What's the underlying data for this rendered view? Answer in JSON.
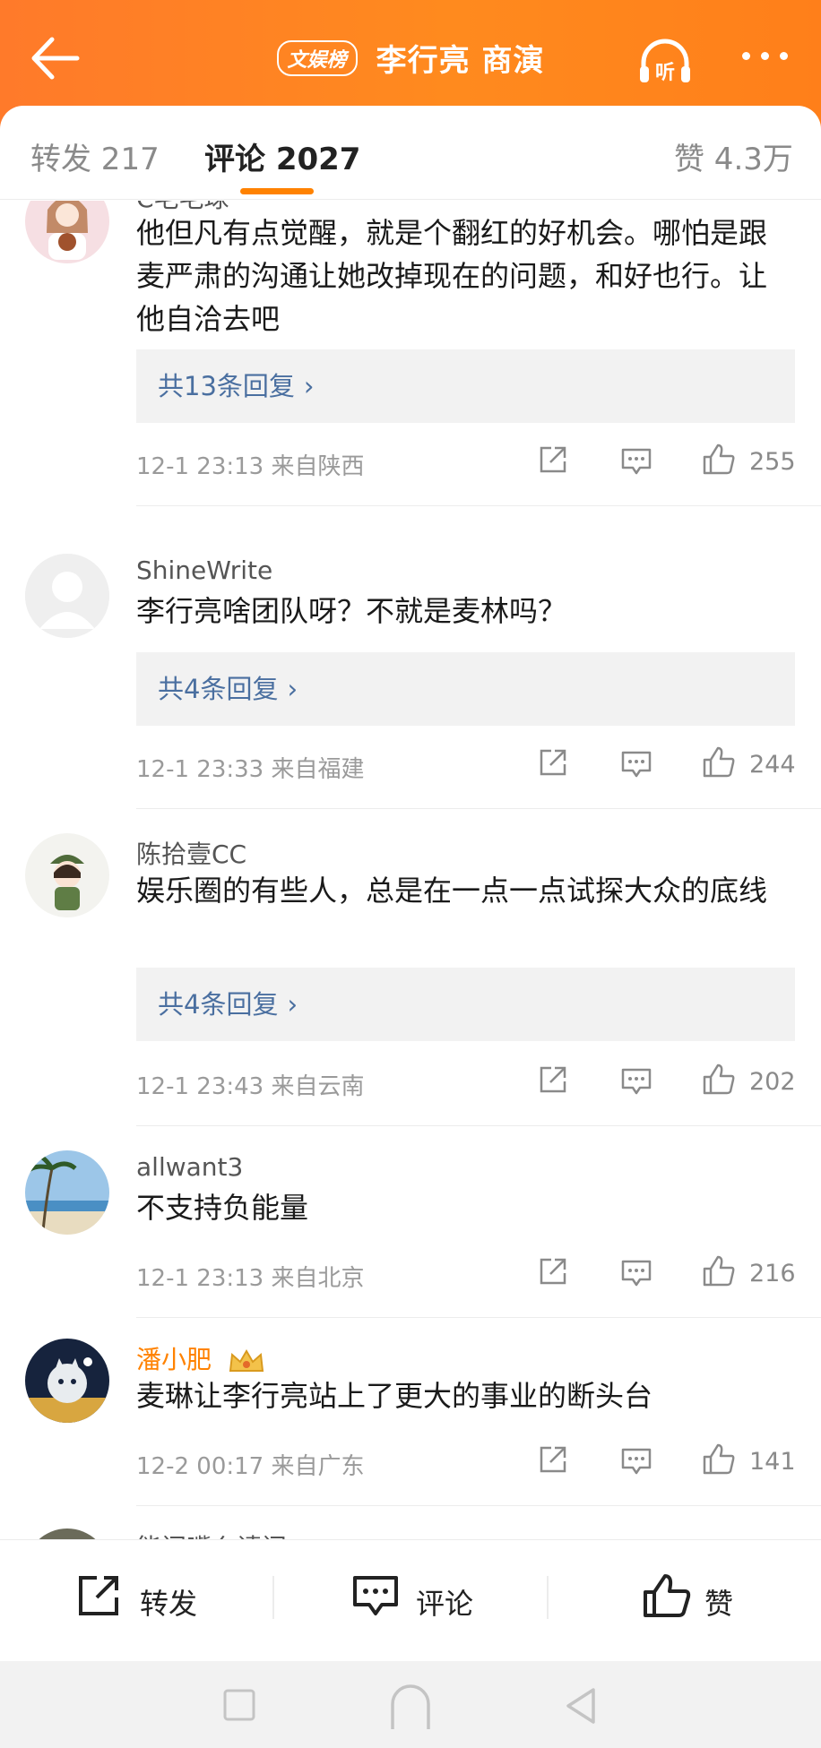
{
  "header": {
    "badge": "文娱榜",
    "title": "李行亮 商演",
    "listen_label": "听"
  },
  "tabs": {
    "repost": "转发 217",
    "comments": "评论 2027",
    "likes": "赞 4.3万"
  },
  "comments": [
    {
      "username": "C毛毛球",
      "text": "他但凡有点觉醒，就是个翻红的好机会。哪怕是跟麦严肃的沟通让她改掉现在的问题，和好也行。让他自洽去吧",
      "replies": "共13条回复",
      "meta": "12-1 23:13  来自陕西",
      "likes": "255"
    },
    {
      "username": "ShineWrite",
      "text": "李行亮啥团队呀？不就是麦林吗？",
      "replies": "共4条回复",
      "meta": "12-1 23:33  来自福建",
      "likes": "244"
    },
    {
      "username": "陈拾壹CC",
      "text": "娱乐圈的有些人，总是在一点一点试探大众的底线",
      "replies": "共4条回复",
      "meta": "12-1 23:43  来自云南",
      "likes": "202"
    },
    {
      "username": "allwant3",
      "text": "不支持负能量",
      "meta": "12-1 23:13  来自北京",
      "likes": "216"
    },
    {
      "username": "潘小肥",
      "text": "麦琳让李行亮站上了更大的事业的断头台",
      "meta": "12-2 00:17  来自广东",
      "likes": "141"
    },
    {
      "username": "能闭嘴么请问"
    }
  ],
  "bottom_bar": {
    "repost": "转发",
    "comment": "评论",
    "like": "赞"
  },
  "colors": {
    "header_orange": "#ff8200",
    "link_blue": "#4a6fa0"
  }
}
